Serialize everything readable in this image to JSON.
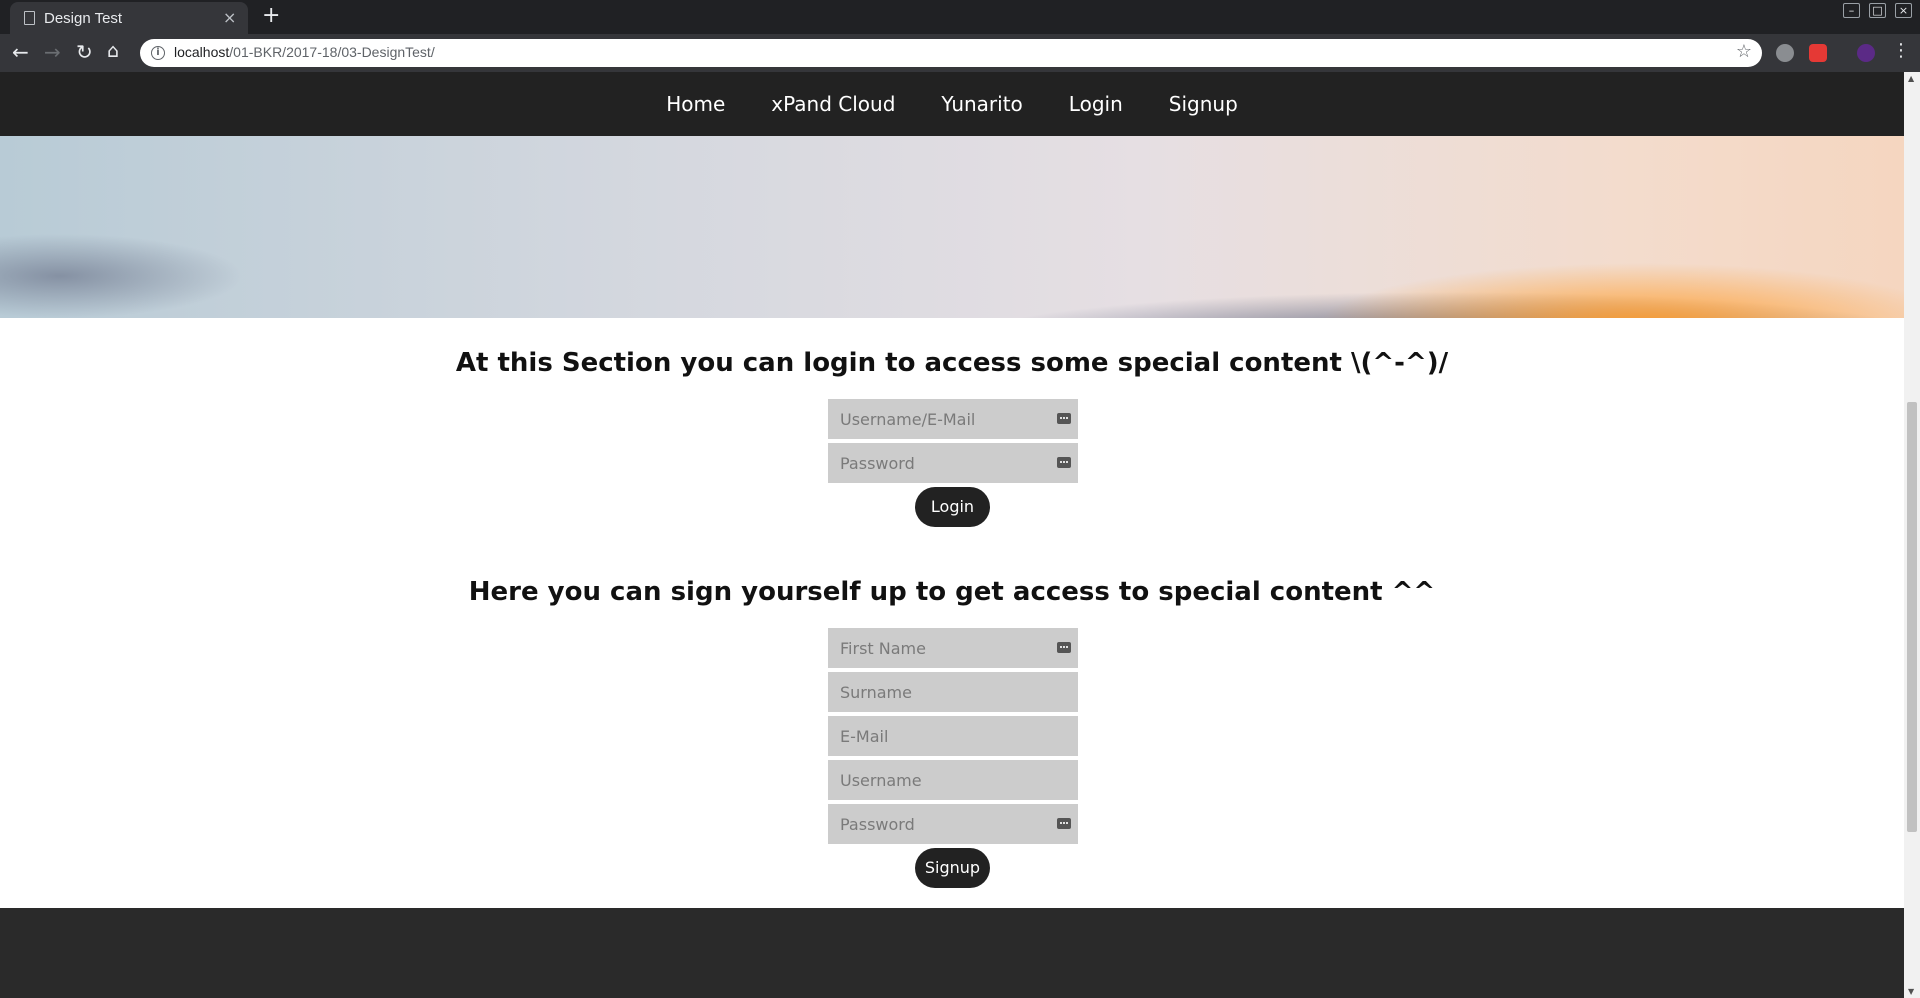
{
  "browser": {
    "tab_title": "Design Test",
    "tab_close": "×",
    "new_tab": "+",
    "url_host": "localhost",
    "url_path": "/01-BKR/2017-18/03-DesignTest/",
    "window_controls": [
      "–",
      "□",
      "×"
    ]
  },
  "nav": {
    "items": [
      {
        "label": "Home"
      },
      {
        "label": "xPand Cloud"
      },
      {
        "label": "Yunarito"
      },
      {
        "label": "Login"
      },
      {
        "label": "Signup"
      }
    ]
  },
  "login_section": {
    "heading": "At this Section you can login to access some special content \\(^-^)/",
    "username_placeholder": "Username/E-Mail",
    "password_placeholder": "Password",
    "button_label": "Login"
  },
  "signup_section": {
    "heading": "Here you can sign yourself up to get access to special content ^^",
    "first_name_placeholder": "First Name",
    "surname_placeholder": "Surname",
    "email_placeholder": "E-Mail",
    "username_placeholder": "Username",
    "password_placeholder": "Password",
    "button_label": "Signup"
  },
  "colors": {
    "nav_bg": "#222222",
    "field_bg": "#cccccc",
    "button_bg": "#222222",
    "footer_bg": "#2a2a2a"
  }
}
